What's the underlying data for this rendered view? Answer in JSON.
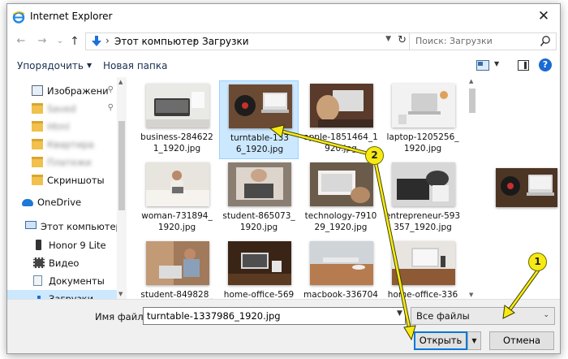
{
  "window": {
    "title": "Internet Explorer",
    "close_glyph": "✕"
  },
  "nav": {
    "back": "←",
    "forward": "→",
    "recent": "⌄",
    "up": "↑",
    "path": [
      "Этот компьютер",
      "Загрузки"
    ],
    "search_placeholder": "Поиск: Загрузки",
    "refresh": "↻"
  },
  "commands": {
    "organize": "Упорядочить",
    "new_folder": "Новая папка",
    "help": "?"
  },
  "sidebar": {
    "items": [
      {
        "label": "Изображени",
        "icon": "pictures-folder-icon",
        "pinned": true,
        "blurred": false
      },
      {
        "label": "Saved",
        "icon": "folder-icon",
        "pinned": true,
        "blurred": true
      },
      {
        "label": "Html",
        "icon": "folder-icon",
        "pinned": false,
        "blurred": true
      },
      {
        "label": "Квартира",
        "icon": "folder-icon",
        "pinned": false,
        "blurred": true
      },
      {
        "label": "Платежи",
        "icon": "folder-icon",
        "pinned": false,
        "blurred": true
      },
      {
        "label": "Скриншоты",
        "icon": "folder-icon",
        "pinned": false,
        "blurred": false
      },
      {
        "label": "OneDrive",
        "icon": "onedrive-icon",
        "pinned": false,
        "blurred": false
      },
      {
        "label": "Этот компьютер",
        "icon": "computer-icon",
        "pinned": false,
        "blurred": false
      },
      {
        "label": "Honor 9 Lite",
        "icon": "phone-icon",
        "pinned": false,
        "blurred": false
      },
      {
        "label": "Видео",
        "icon": "video-icon",
        "pinned": false,
        "blurred": false
      },
      {
        "label": "Документы",
        "icon": "documents-icon",
        "pinned": false,
        "blurred": false
      },
      {
        "label": "Загрузки",
        "icon": "downloads-icon",
        "pinned": false,
        "blurred": false,
        "selected": true
      }
    ]
  },
  "files": [
    {
      "name": "business-2846221_1920.jpg",
      "line1": "business-284622",
      "line2": "1_1920.jpg",
      "art": "laptop-desk"
    },
    {
      "name": "turntable-1337986_1920.jpg",
      "line1": "turntable-133",
      "line2": "6_1920.jpg",
      "art": "turntable",
      "selected": true
    },
    {
      "name": "apple-1851464_1920.jpg",
      "line1": "apple-1851464_1",
      "line2": "920.jpg",
      "art": "apple"
    },
    {
      "name": "laptop-1205256_1920.jpg",
      "line1": "laptop-1205256_",
      "line2": "1920.jpg",
      "art": "laptop-white"
    },
    {
      "name": "woman-731894_1920.jpg",
      "line1": "woman-731894_",
      "line2": "1920.jpg",
      "art": "woman"
    },
    {
      "name": "student-865073_1920.jpg",
      "line1": "student-865073_",
      "line2": "1920.jpg",
      "art": "student"
    },
    {
      "name": "technology-791029_1920.jpg",
      "line1": "technology-7910",
      "line2": "29_1920.jpg",
      "art": "technology"
    },
    {
      "name": "entrepreneur-593357_1920.jpg",
      "line1": "entrepreneur-593",
      "line2": "357_1920.jpg",
      "art": "entrepreneur"
    },
    {
      "name": "student-849828",
      "line1": "student-849828_",
      "line2": "",
      "art": "student2"
    },
    {
      "name": "home-office-569",
      "line1": "home-office-569",
      "line2": "",
      "art": "homeoffice"
    },
    {
      "name": "macbook-336704",
      "line1": "macbook-336704",
      "line2": "",
      "art": "macbook"
    },
    {
      "name": "home-office-336",
      "line1": "home-office-336",
      "line2": "",
      "art": "homeoffice2"
    }
  ],
  "footer": {
    "filename_label": "Имя файла:",
    "filename_value": "turntable-1337986_1920.jpg",
    "filetype_value": "Все файлы",
    "open_label": "Открыть",
    "cancel_label": "Отмена"
  },
  "annotations": [
    {
      "number": "1"
    },
    {
      "number": "2"
    }
  ],
  "colors": {
    "accent": "#0078d7",
    "selection": "#cce8ff",
    "arrow": "#f7ea14"
  }
}
